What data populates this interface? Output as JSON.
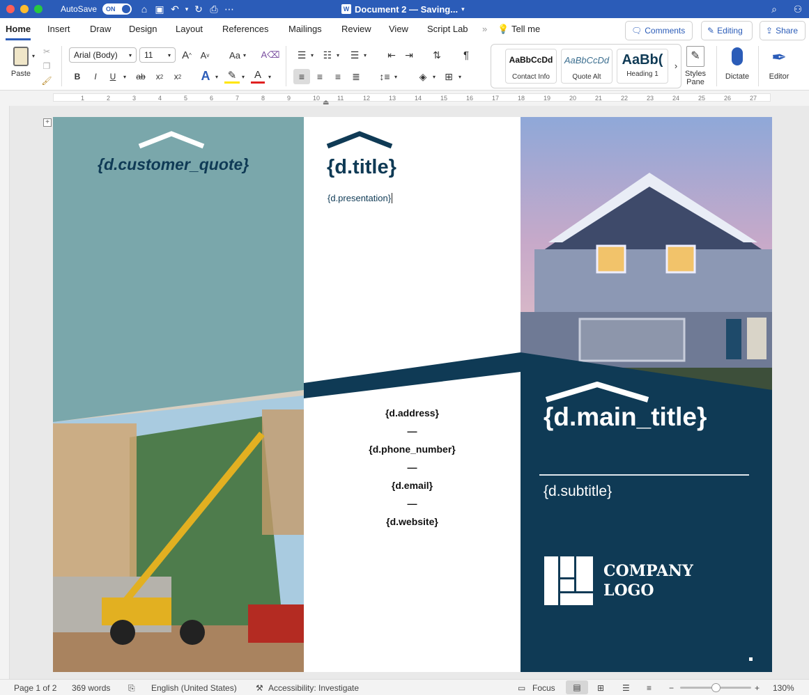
{
  "titlebar": {
    "autosave_label": "AutoSave",
    "autosave_state": "ON",
    "doc_title": "Document 2 — Saving...",
    "colors": {
      "bar": "#2b5cb8",
      "close": "#fe5f57",
      "minimize": "#febc2e",
      "maximize": "#28c840"
    },
    "icons": [
      "home-icon",
      "save-icon",
      "undo-icon",
      "redo-icon",
      "print-icon",
      "more-icon",
      "search-icon",
      "share-person-icon"
    ]
  },
  "tabs": [
    "Home",
    "Insert",
    "Draw",
    "Design",
    "Layout",
    "References",
    "Mailings",
    "Review",
    "View",
    "Script Lab"
  ],
  "tell_me": "Tell me",
  "top_buttons": {
    "comments": "Comments",
    "editing": "Editing",
    "share": "Share"
  },
  "ribbon": {
    "paste_label": "Paste",
    "font_name": "Arial (Body)",
    "font_size": "11",
    "grow_font": "A",
    "shrink_font": "A",
    "change_case": "Aa",
    "bold": "B",
    "italic": "I",
    "underline": "U",
    "strike": "ab",
    "subscript": "x",
    "superscript": "x",
    "pilcrow": "¶",
    "styles": [
      {
        "sample": "AaBbCcDd",
        "name": "Contact Info"
      },
      {
        "sample": "AaBbCcDd",
        "name": "Quote Alt"
      },
      {
        "sample": "AaBb(",
        "name": "Heading 1"
      }
    ],
    "styles_pane": "Styles Pane",
    "dictate": "Dictate",
    "editor": "Editor"
  },
  "ruler_numbers": [
    "1",
    "2",
    "3",
    "4",
    "5",
    "6",
    "7",
    "8",
    "9",
    "10",
    "11",
    "12",
    "13",
    "14",
    "15",
    "16",
    "17",
    "18",
    "19",
    "20",
    "21",
    "22",
    "23",
    "24",
    "25",
    "26",
    "27"
  ],
  "document": {
    "customer_quote": "{d.customer_quote}",
    "title": "{d.title}",
    "presentation": "{d.presentation}",
    "address": "{d.address}",
    "dash": "—",
    "phone_number": "{d.phone_number}",
    "email": "{d.email}",
    "website": "{d.website}",
    "logo_line1": "COMPANY",
    "logo_line2": "LOGO",
    "main_title": "{d.main_title}",
    "subtitle": "{d.subtitle}",
    "colors": {
      "teal": "#7aa7ab",
      "navy": "#0f3a55",
      "white": "#ffffff"
    }
  },
  "statusbar": {
    "page": "Page 1 of 2",
    "words": "369 words",
    "language": "English (United States)",
    "accessibility": "Accessibility: Investigate",
    "focus": "Focus",
    "zoom_minus": "−",
    "zoom_plus": "+",
    "zoom": "130%",
    "zoom_slider_fraction": 0.5
  }
}
